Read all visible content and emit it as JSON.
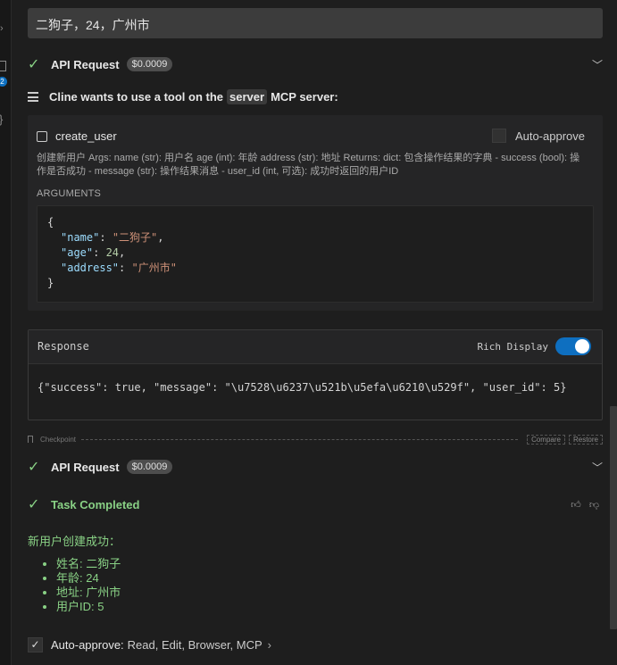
{
  "user_message": "二狗子，24，广州市",
  "api_request_1": {
    "label": "API Request",
    "cost": "$0.0009"
  },
  "mcp": {
    "prefix": "Cline wants to use a tool on the",
    "server": "server",
    "suffix": "MCP server:",
    "tool_name": "create_user",
    "auto_approve_label": "Auto-approve",
    "description": "创建新用户 Args: name (str): 用户名 age (int): 年龄 address (str): 地址 Returns: dict: 包含操作结果的字典 - success (bool): 操作是否成功 - message (str): 操作结果消息 - user_id (int, 可选): 成功时返回的用户ID",
    "arguments_label": "ARGUMENTS",
    "args": {
      "open": "{",
      "name_key": "\"name\"",
      "name_val": "\"二狗子\"",
      "age_key": "\"age\"",
      "age_val": "24",
      "address_key": "\"address\"",
      "address_val": "\"广州市\"",
      "close": "}"
    }
  },
  "response": {
    "title": "Response",
    "rich_display_label": "Rich Display",
    "rich_display_on": true,
    "body": "{\"success\": true, \"message\": \"\\u7528\\u6237\\u521b\\u5efa\\u6210\\u529f\", \"user_id\": 5}"
  },
  "checkpoint": {
    "label": "Checkpoint",
    "compare": "Compare",
    "restore": "Restore"
  },
  "api_request_2": {
    "label": "API Request",
    "cost": "$0.0009"
  },
  "task": {
    "label": "Task Completed",
    "result_title": "新用户创建成功：",
    "items": [
      "姓名: 二狗子",
      "年龄: 24",
      "地址: 广州市",
      "用户ID: 5"
    ]
  },
  "auto_approve": {
    "label": "Auto-approve:",
    "value": "Read, Edit, Browser, MCP"
  },
  "colors": {
    "success": "#89d185",
    "accent": "#0e6fc0",
    "background": "#1e1e1e"
  },
  "sidebar_badge": "2"
}
